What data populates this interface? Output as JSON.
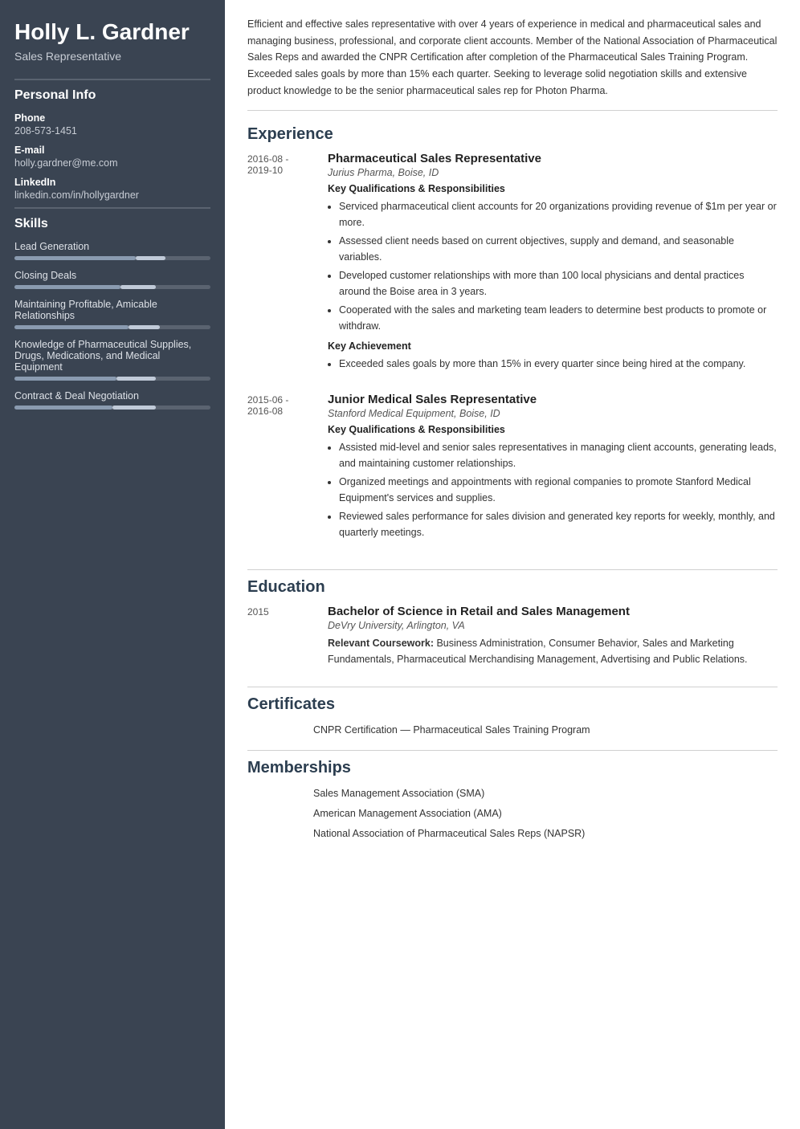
{
  "sidebar": {
    "name": "Holly L. Gardner",
    "title": "Sales Representative",
    "personal_info_heading": "Personal Info",
    "phone_label": "Phone",
    "phone_value": "208-573-1451",
    "email_label": "E-mail",
    "email_value": "holly.gardner@me.com",
    "linkedin_label": "LinkedIn",
    "linkedin_value": "linkedin.com/in/hollygardner",
    "skills_heading": "Skills",
    "skills": [
      {
        "name": "Lead Generation",
        "fill_width": "62%",
        "accent_left": "62%",
        "accent_width": "15%"
      },
      {
        "name": "Closing Deals",
        "fill_width": "54%",
        "accent_left": "54%",
        "accent_width": "18%"
      },
      {
        "name": "Maintaining Profitable, Amicable Relationships",
        "fill_width": "58%",
        "accent_left": "58%",
        "accent_width": "16%"
      },
      {
        "name": "Knowledge of Pharmaceutical Supplies, Drugs, Medications, and Medical Equipment",
        "fill_width": "52%",
        "accent_left": "52%",
        "accent_width": "20%"
      },
      {
        "name": "Contract & Deal Negotiation",
        "fill_width": "50%",
        "accent_left": "50%",
        "accent_width": "22%"
      }
    ]
  },
  "main": {
    "summary": "Efficient and effective sales representative with over 4 years of experience in medical and pharmaceutical sales and managing business, professional, and corporate client accounts. Member of the National Association of Pharmaceutical Sales Reps and awarded the CNPR Certification after completion of the Pharmaceutical Sales Training Program. Exceeded sales goals by more than 15% each quarter. Seeking to leverage solid negotiation skills and extensive product knowledge to be the senior pharmaceutical sales rep for Photon Pharma.",
    "experience_heading": "Experience",
    "experiences": [
      {
        "date_start": "2016-08 -",
        "date_end": "2019-10",
        "job_title": "Pharmaceutical Sales Representative",
        "company": "Jurius Pharma, Boise, ID",
        "qualifications_heading": "Key Qualifications & Responsibilities",
        "bullets": [
          "Serviced pharmaceutical client accounts for 20 organizations providing revenue of $1m per year or more.",
          "Assessed client needs based on current objectives, supply and demand, and seasonable variables.",
          "Developed customer relationships with more than 100 local physicians and dental practices around the Boise area in 3 years.",
          "Cooperated with the sales and marketing team leaders to determine best products to promote or withdraw."
        ],
        "achievement_heading": "Key Achievement",
        "achievement_bullets": [
          "Exceeded sales goals by more than 15% in every quarter since being hired at the company."
        ]
      },
      {
        "date_start": "2015-06 -",
        "date_end": "2016-08",
        "job_title": "Junior Medical Sales Representative",
        "company": "Stanford Medical Equipment, Boise, ID",
        "qualifications_heading": "Key Qualifications & Responsibilities",
        "bullets": [
          "Assisted mid-level and senior sales representatives in managing client accounts, generating leads, and maintaining customer relationships.",
          "Organized meetings and appointments with regional companies to promote Stanford Medical Equipment's services and supplies.",
          "Reviewed sales performance for sales division and generated key reports for weekly, monthly, and quarterly meetings."
        ],
        "achievement_heading": null,
        "achievement_bullets": []
      }
    ],
    "education_heading": "Education",
    "education": [
      {
        "year": "2015",
        "degree": "Bachelor of Science in Retail and Sales Management",
        "school": "DeVry University, Arlington, VA",
        "coursework_label": "Relevant Coursework:",
        "coursework": "Business Administration, Consumer Behavior, Sales and Marketing Fundamentals, Pharmaceutical Merchandising Management, Advertising and Public Relations."
      }
    ],
    "certificates_heading": "Certificates",
    "certificates": [
      "CNPR Certification — Pharmaceutical Sales Training Program"
    ],
    "memberships_heading": "Memberships",
    "memberships": [
      "Sales Management Association (SMA)",
      "American Management Association (AMA)",
      "National Association of Pharmaceutical Sales Reps (NAPSR)"
    ]
  }
}
